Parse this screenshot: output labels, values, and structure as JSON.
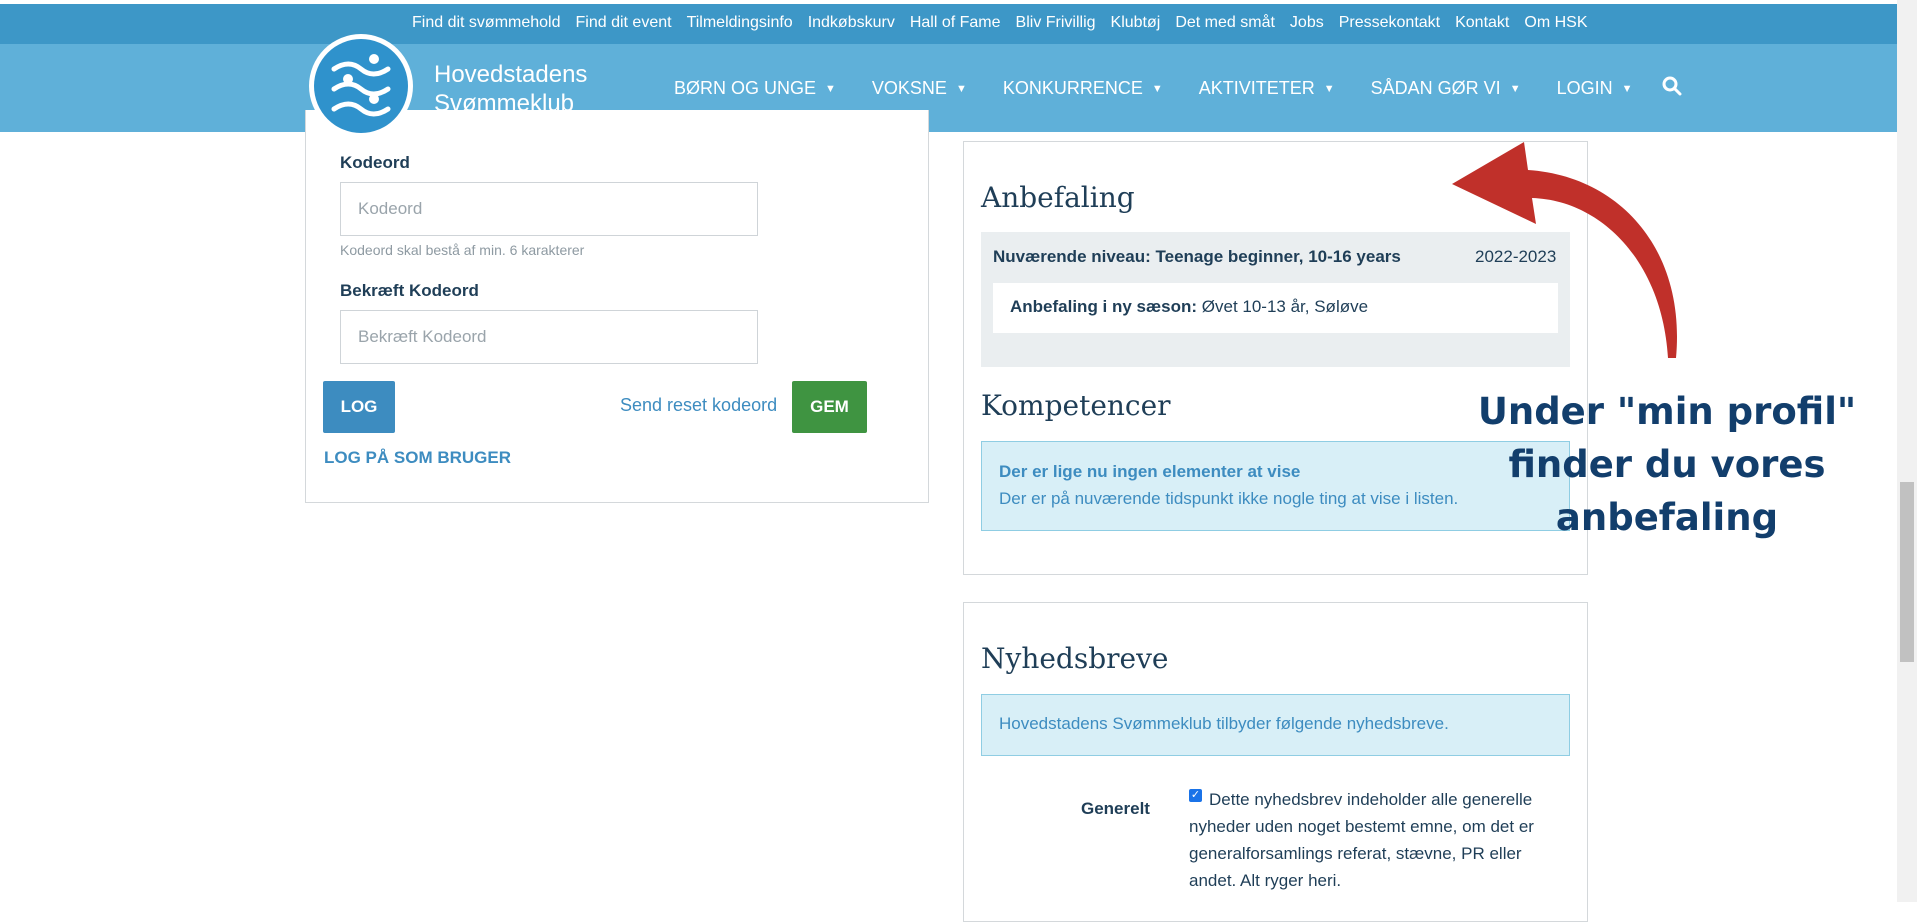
{
  "top_links": [
    "Find dit svømmehold",
    "Find dit event",
    "Tilmeldingsinfo",
    "Indkøbskurv",
    "Hall of Fame",
    "Bliv Frivillig",
    "Klubtøj",
    "Det med småt",
    "Jobs",
    "Pressekontakt",
    "Kontakt",
    "Om HSK"
  ],
  "brand": {
    "line1": "Hovedstadens",
    "line2": "Svømmeklub"
  },
  "nav": {
    "items": [
      "BØRN OG UNGE",
      "VOKSNE",
      "KONKURRENCE",
      "AKTIVITETER",
      "SÅDAN GØR VI",
      "LOGIN"
    ],
    "search_icon": "search-icon"
  },
  "login_form": {
    "password_label": "Kodeord",
    "password_placeholder": "Kodeord",
    "password_hint": "Kodeord skal bestå af min. 6 karakterer",
    "confirm_label": "Bekræft Kodeord",
    "confirm_placeholder": "Bekræft Kodeord",
    "log_button": "LOG",
    "reset_link": "Send reset kodeord",
    "save_button": "GEM",
    "login_as_user": "LOG PÅ SOM BRUGER"
  },
  "recommendation": {
    "heading": "Anbefaling",
    "current_level": "Nuværende niveau: Teenage beginner, 10-16 years",
    "season": "2022-2023",
    "new_season_label": "Anbefaling i ny sæson:",
    "new_season_value": "Øvet 10-13 år, Søløve"
  },
  "competences": {
    "heading": "Kompetencer",
    "empty_title": "Der er lige nu ingen elementer at vise",
    "empty_text": "Der er på nuværende tidspunkt ikke nogle ting at vise i listen."
  },
  "newsletters": {
    "heading": "Nyhedsbreve",
    "intro": "Hovedstadens Svømmeklub tilbyder følgende nyhedsbreve.",
    "items": [
      {
        "label": "Generelt",
        "checked": true,
        "description": "Dette nyhedsbrev indeholder alle generelle nyheder uden noget bestemt emne, om det er generalforsamlings referat, stævne, PR eller andet. Alt ryger heri."
      }
    ]
  },
  "annotation": {
    "text": "Under \"min profil\" finder du vores anbefaling",
    "color": "#123e6c",
    "arrow_color": "#c0302a"
  },
  "colors": {
    "topbar": "#3d97c7",
    "mainbar": "#5fb0d9",
    "primary_button": "#3d8cc0",
    "save_button": "#3f9441"
  }
}
